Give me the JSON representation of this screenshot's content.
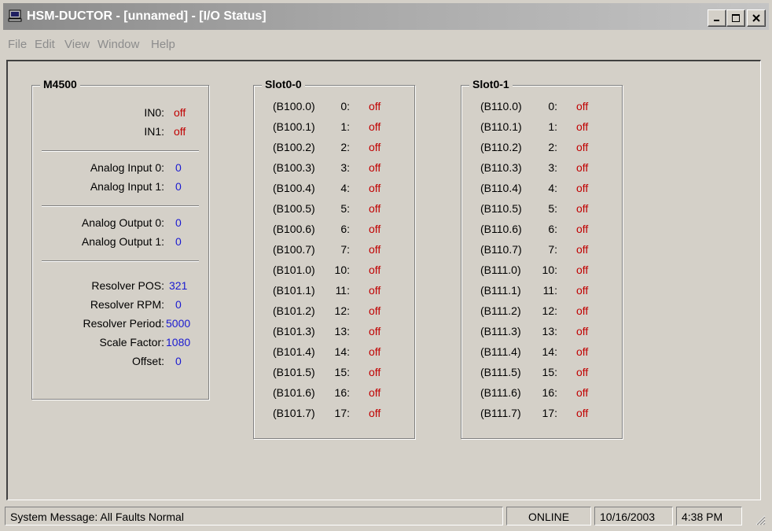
{
  "window": {
    "title": "HSM-DUCTOR - [unnamed] - [I/O Status]"
  },
  "menu": [
    "File",
    "Edit",
    "View",
    "Window",
    "Help"
  ],
  "m4500": {
    "title": "M4500",
    "rows": [
      {
        "label": "IN0:",
        "value": "off",
        "kind": "off"
      },
      {
        "label": "IN1:",
        "value": "off",
        "kind": "off"
      },
      {
        "label": "Analog Input 0:",
        "value": "0",
        "kind": "num"
      },
      {
        "label": "Analog Input 1:",
        "value": "0",
        "kind": "num"
      },
      {
        "label": "Analog Output 0:",
        "value": "0",
        "kind": "num"
      },
      {
        "label": "Analog Output 1:",
        "value": "0",
        "kind": "num"
      },
      {
        "label": "Resolver POS:",
        "value": "321",
        "kind": "num"
      },
      {
        "label": "Resolver RPM:",
        "value": "0",
        "kind": "num"
      },
      {
        "label": "Resolver Period:",
        "value": "5000",
        "kind": "num"
      },
      {
        "label": "Scale Factor:",
        "value": "1080",
        "kind": "num"
      },
      {
        "label": "Offset:",
        "value": "0",
        "kind": "num"
      }
    ]
  },
  "slot0_0": {
    "title": "Slot0-0",
    "rows": [
      {
        "addr": "(B100.0)",
        "idx": "0:",
        "value": "off"
      },
      {
        "addr": "(B100.1)",
        "idx": "1:",
        "value": "off"
      },
      {
        "addr": "(B100.2)",
        "idx": "2:",
        "value": "off"
      },
      {
        "addr": "(B100.3)",
        "idx": "3:",
        "value": "off"
      },
      {
        "addr": "(B100.4)",
        "idx": "4:",
        "value": "off"
      },
      {
        "addr": "(B100.5)",
        "idx": "5:",
        "value": "off"
      },
      {
        "addr": "(B100.6)",
        "idx": "6:",
        "value": "off"
      },
      {
        "addr": "(B100.7)",
        "idx": "7:",
        "value": "off"
      },
      {
        "addr": "(B101.0)",
        "idx": "10:",
        "value": "off"
      },
      {
        "addr": "(B101.1)",
        "idx": "11:",
        "value": "off"
      },
      {
        "addr": "(B101.2)",
        "idx": "12:",
        "value": "off"
      },
      {
        "addr": "(B101.3)",
        "idx": "13:",
        "value": "off"
      },
      {
        "addr": "(B101.4)",
        "idx": "14:",
        "value": "off"
      },
      {
        "addr": "(B101.5)",
        "idx": "15:",
        "value": "off"
      },
      {
        "addr": "(B101.6)",
        "idx": "16:",
        "value": "off"
      },
      {
        "addr": "(B101.7)",
        "idx": "17:",
        "value": "off"
      }
    ]
  },
  "slot0_1": {
    "title": "Slot0-1",
    "rows": [
      {
        "addr": "(B110.0)",
        "idx": "0:",
        "value": "off"
      },
      {
        "addr": "(B110.1)",
        "idx": "1:",
        "value": "off"
      },
      {
        "addr": "(B110.2)",
        "idx": "2:",
        "value": "off"
      },
      {
        "addr": "(B110.3)",
        "idx": "3:",
        "value": "off"
      },
      {
        "addr": "(B110.4)",
        "idx": "4:",
        "value": "off"
      },
      {
        "addr": "(B110.5)",
        "idx": "5:",
        "value": "off"
      },
      {
        "addr": "(B110.6)",
        "idx": "6:",
        "value": "off"
      },
      {
        "addr": "(B110.7)",
        "idx": "7:",
        "value": "off"
      },
      {
        "addr": "(B111.0)",
        "idx": "10:",
        "value": "off"
      },
      {
        "addr": "(B111.1)",
        "idx": "11:",
        "value": "off"
      },
      {
        "addr": "(B111.2)",
        "idx": "12:",
        "value": "off"
      },
      {
        "addr": "(B111.3)",
        "idx": "13:",
        "value": "off"
      },
      {
        "addr": "(B111.4)",
        "idx": "14:",
        "value": "off"
      },
      {
        "addr": "(B111.5)",
        "idx": "15:",
        "value": "off"
      },
      {
        "addr": "(B111.6)",
        "idx": "16:",
        "value": "off"
      },
      {
        "addr": "(B111.7)",
        "idx": "17:",
        "value": "off"
      }
    ]
  },
  "status": {
    "message": "System Message:  All Faults Normal",
    "mode": "ONLINE",
    "date": "10/16/2003",
    "time": "4:38 PM"
  },
  "colors": {
    "off": "#c00000",
    "number": "#1a1ad0",
    "face": "#d4d0c8"
  },
  "icons": [
    "computer-icon",
    "minimize-icon",
    "maximize-icon",
    "close-icon",
    "size-grip-icon"
  ]
}
